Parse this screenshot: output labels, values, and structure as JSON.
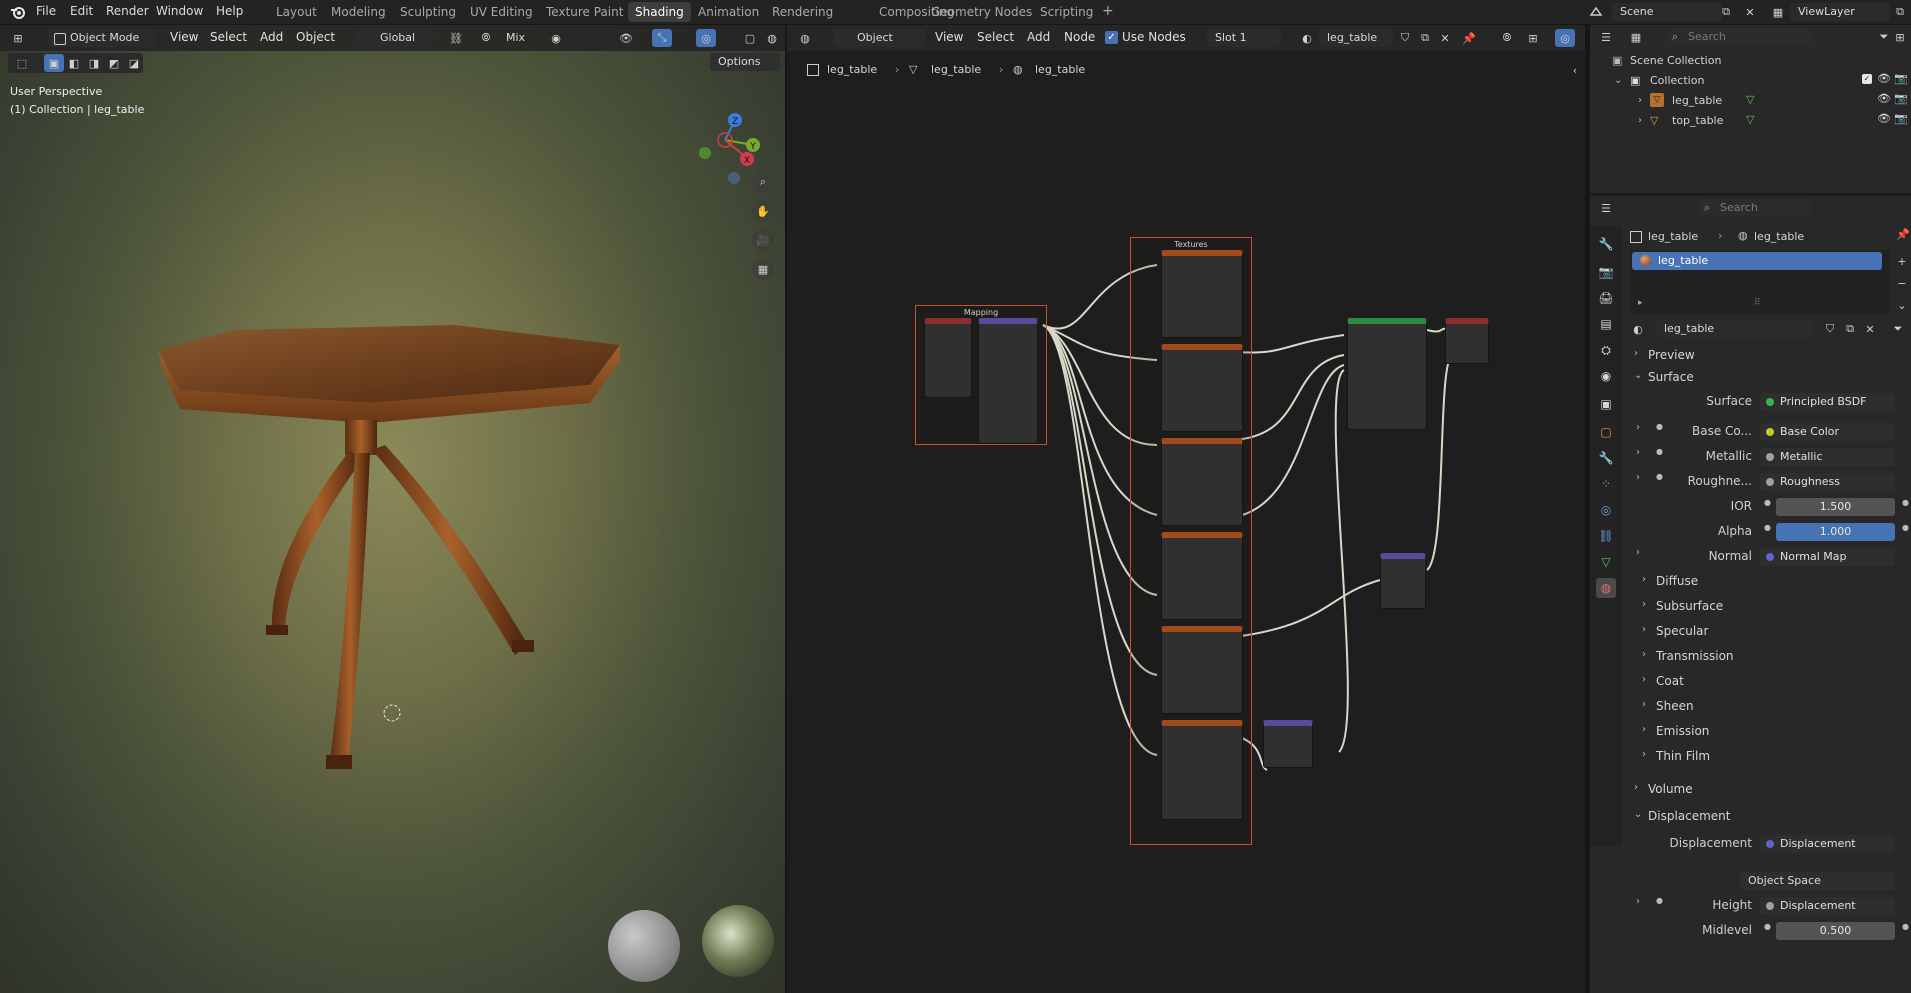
{
  "menu": {
    "file": "File",
    "edit": "Edit",
    "render": "Render",
    "window": "Window",
    "help": "Help"
  },
  "workspaces": [
    "Layout",
    "Modeling",
    "Sculpting",
    "UV Editing",
    "Texture Paint",
    "Shading",
    "Animation",
    "Rendering",
    "Compositing",
    "Geometry Nodes",
    "Scripting"
  ],
  "active_workspace": "Shading",
  "add_workspace": "+",
  "scene": {
    "name": "Scene",
    "view_layer": "ViewLayer"
  },
  "viewport": {
    "mode": "Object Mode",
    "menus": [
      "View",
      "Select",
      "Add",
      "Object"
    ],
    "transform_orientation": "Global",
    "snap_mix": "Mix",
    "options_label": "Options",
    "overlay_line1": "User Perspective",
    "overlay_line2": "(1) Collection | leg_table",
    "gizmo": {
      "x": "X",
      "y": "Y",
      "z": "Z"
    }
  },
  "node_editor": {
    "type": "Object",
    "menus": [
      "View",
      "Select",
      "Add",
      "Node"
    ],
    "use_nodes_label": "Use Nodes",
    "slot": "Slot 1",
    "material": "leg_table",
    "breadcrumb": [
      "leg_table",
      "leg_table",
      "leg_table"
    ],
    "frames": {
      "mapping": "Mapping",
      "textures": "Textures"
    }
  },
  "outliner": {
    "search_placeholder": "Search",
    "root": "Scene Collection",
    "collection": "Collection",
    "objects": [
      "leg_table",
      "top_table"
    ]
  },
  "properties": {
    "search_placeholder": "Search",
    "breadcrumb": [
      "leg_table",
      "leg_table"
    ],
    "material_slot": "leg_table",
    "material_name": "leg_table",
    "sections": {
      "preview": "Preview",
      "surface": "Surface",
      "volume": "Volume",
      "displacement": "Displacement"
    },
    "surface_rows": [
      {
        "label": "Surface",
        "value": "Principled BSDF",
        "dot": "#39b54a"
      },
      {
        "label": "Base Co...",
        "value": "Base Color",
        "dot": "#c8c832"
      },
      {
        "label": "Metallic",
        "value": "Metallic",
        "dot": "#a1a1a1"
      },
      {
        "label": "Roughne...",
        "value": "Roughness",
        "dot": "#a1a1a1"
      }
    ],
    "ior": {
      "label": "IOR",
      "value": "1.500"
    },
    "alpha": {
      "label": "Alpha",
      "value": "1.000"
    },
    "normal": {
      "label": "Normal",
      "value": "Normal Map",
      "dot": "#6363c7"
    },
    "subpanels": [
      "Diffuse",
      "Subsurface",
      "Specular",
      "Transmission",
      "Coat",
      "Sheen",
      "Emission",
      "Thin Film"
    ],
    "displacement_rows": {
      "displacement_label": "Displacement",
      "displacement_value": "Displacement",
      "space": "Object Space",
      "height_label": "Height",
      "height_value": "Displacement",
      "midlevel_label": "Midlevel",
      "midlevel_value": "0.500"
    }
  },
  "colors": {
    "accent": "#4772b3",
    "frame_border": "#c4552b",
    "header": "#232323"
  }
}
